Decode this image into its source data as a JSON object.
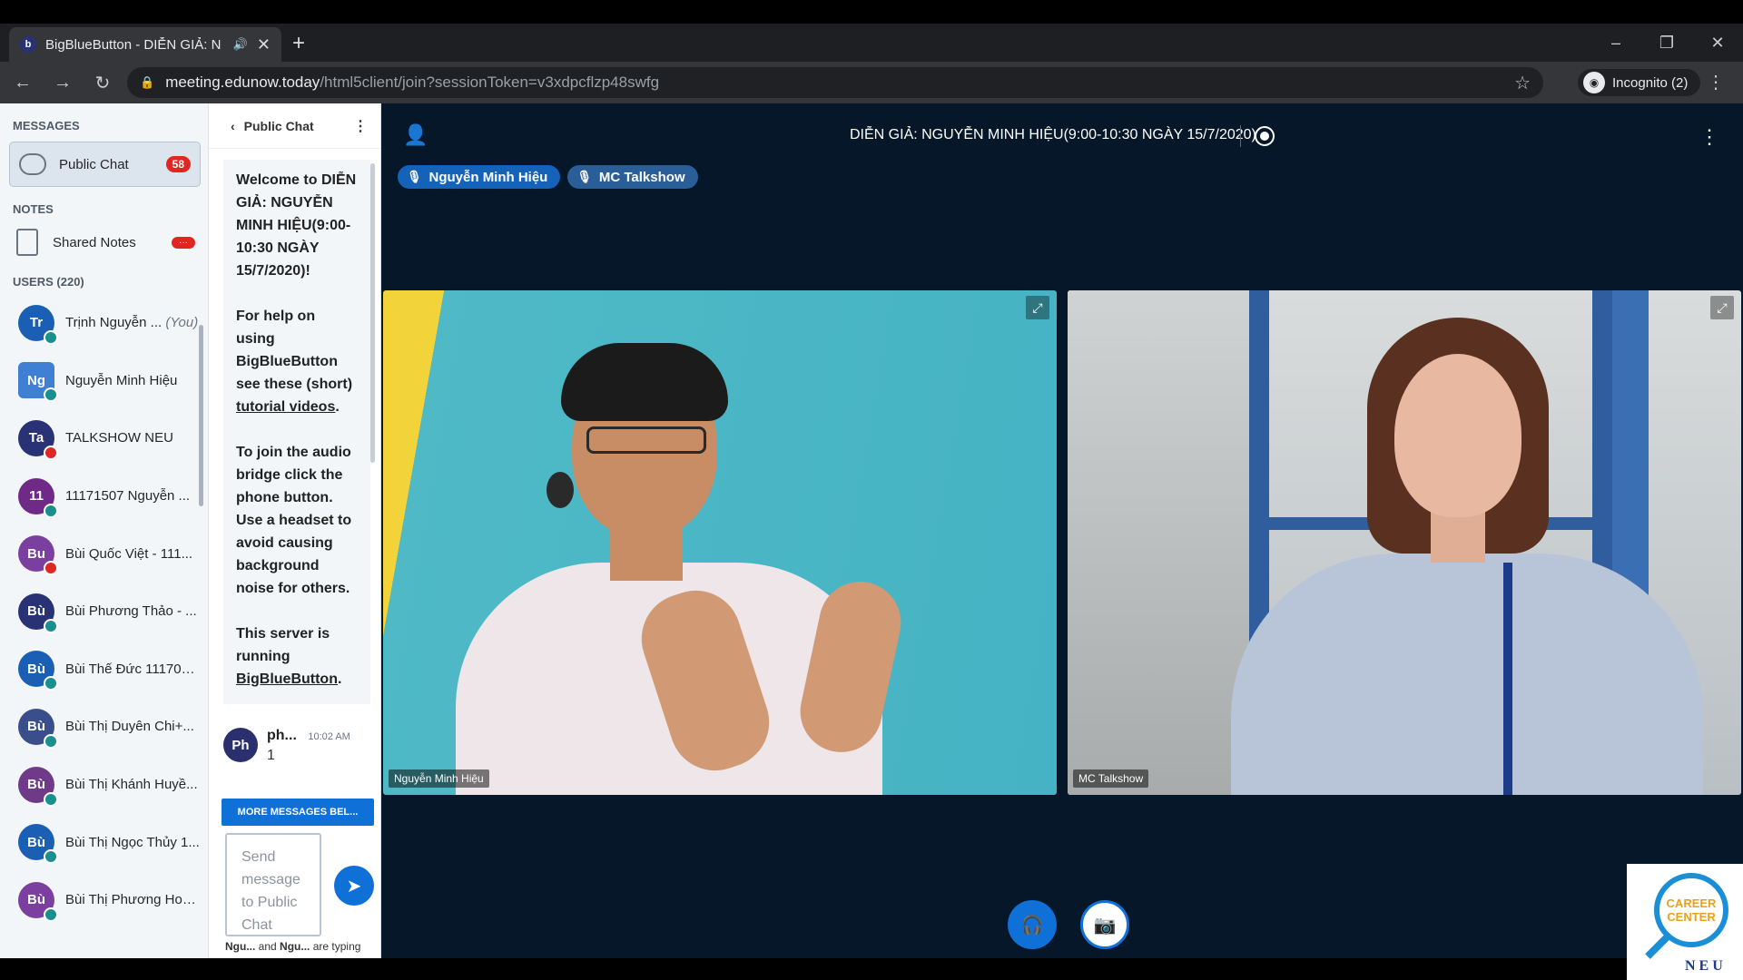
{
  "browser": {
    "tab_title": "BigBlueButton - DIỄN GIẢ: N",
    "favicon": "b",
    "url_host": "meeting.edunow.today",
    "url_path": "/html5client/join?sessionToken=v3xdpcflzp48swfg",
    "incognito_label": "Incognito (2)"
  },
  "sidebar": {
    "messages_title": "MESSAGES",
    "public_chat_label": "Public Chat",
    "public_chat_badge": "58",
    "notes_title": "NOTES",
    "shared_notes_label": "Shared Notes",
    "shared_notes_badge": "···",
    "users_title": "USERS (220)",
    "users": [
      {
        "initials": "Tr",
        "name": "Trịnh Nguyễn ...",
        "you": "(You)",
        "color": "#1a5fb4",
        "status": "#1a8f8f"
      },
      {
        "initials": "Ng",
        "name": "Nguyễn Minh Hiệu",
        "you": "",
        "color": "#3f7fd4",
        "status": "#1a8f8f"
      },
      {
        "initials": "Ta",
        "name": "TALKSHOW NEU",
        "you": "",
        "color": "#283274",
        "status": "#df2721"
      },
      {
        "initials": "11",
        "name": "11171507 Nguyễn ...",
        "you": "",
        "color": "#6f2a88",
        "status": "#1a8f8f"
      },
      {
        "initials": "Bu",
        "name": "Bùi Quốc Việt - 111...",
        "you": "",
        "color": "#7b3fa0",
        "status": "#df2721"
      },
      {
        "initials": "Bù",
        "name": "Bùi Phương Thảo - ...",
        "you": "",
        "color": "#283274",
        "status": "#1a8f8f"
      },
      {
        "initials": "Bù",
        "name": "Bùi Thế Đức 111708...",
        "you": "",
        "color": "#1a5fb4",
        "status": "#1a8f8f"
      },
      {
        "initials": "Bù",
        "name": "Bùi Thị Duyên Chi+...",
        "you": "",
        "color": "#3a4e8c",
        "status": "#1a8f8f"
      },
      {
        "initials": "Bù",
        "name": "Bùi Thị Khánh Huyề...",
        "you": "",
        "color": "#6f3a88",
        "status": "#1a8f8f"
      },
      {
        "initials": "Bù",
        "name": "Bùi Thị Ngọc Thủy 1...",
        "you": "",
        "color": "#1a5fb4",
        "status": "#1a8f8f"
      },
      {
        "initials": "Bù",
        "name": "Bùi Thị Phương Hoa...",
        "you": "",
        "color": "#7b3fa0",
        "status": "#1a8f8f"
      }
    ]
  },
  "chat": {
    "header": "Public Chat",
    "welcome": {
      "p1": "Welcome to DIỄN GIẢ: NGUYỄN MINH HIỆU(9:00-10:30 NGÀY 15/7/2020)!",
      "p2_pre": "For help on using BigBlueButton see these (short) ",
      "p2_link": "tutorial videos",
      "p2_post": ".",
      "p3": "To join the audio bridge click the phone button. Use a headset to avoid causing background noise for others.",
      "p4_pre": "This server is running ",
      "p4_link": "BigBlueButton",
      "p4_post": "."
    },
    "message": {
      "initials": "Ph",
      "author": "ph...",
      "time": "10:02 AM",
      "text": "1"
    },
    "more_button": "MORE MESSAGES BEL...",
    "input_placeholder": "Send message to Public Chat",
    "typing_user1": "Ngu...",
    "typing_and": "and",
    "typing_user2": "Ngu...",
    "typing_suffix": "are typing"
  },
  "stage": {
    "meeting_title": "DIỄN GIẢ: NGUYỄN MINH HIỆU(9:00-10:30 NGÀY 15/7/2020)",
    "talkers": [
      "Nguyễn Minh Hiệu",
      "MC Talkshow"
    ],
    "videos": [
      {
        "name": "Nguyễn Minh Hiệu"
      },
      {
        "name": "MC Talkshow"
      }
    ]
  },
  "logo": {
    "line1": "CAREER",
    "line2": "CENTER",
    "brand": "NEU"
  },
  "colors": {
    "accent": "#0f70d7",
    "stage_bg": "#06172a",
    "badge": "#df2721"
  }
}
